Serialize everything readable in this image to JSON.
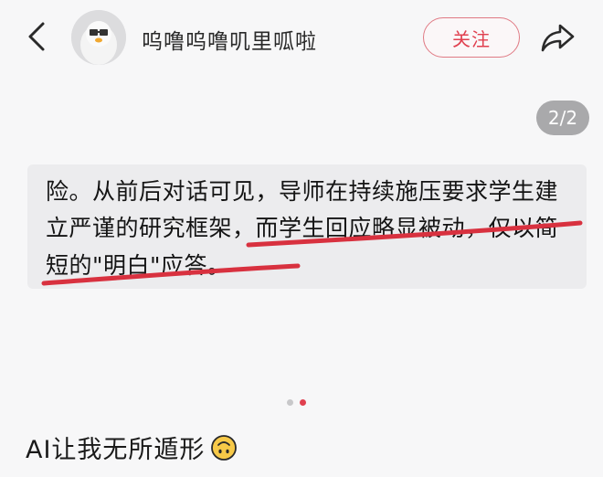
{
  "header": {
    "username": "呜噜呜噜叽里呱啦",
    "follow_label": "关注"
  },
  "gallery": {
    "page_indicator": "2/2",
    "current_index": 2,
    "total": 2
  },
  "content": {
    "line1": "险。从前后对话可见，导师在持续施压要求学生建",
    "line2": "立严谨的研究框架，而学生回应略显被动，仅以简",
    "line3": "短的\"明白\"应答。"
  },
  "caption": {
    "text": "AI让我无所遁形"
  },
  "icons": {
    "back": "chevron-left-icon",
    "share": "share-arrow-icon",
    "emoji": "upside-down-face-emoji"
  },
  "colors": {
    "accent": "#e0404f",
    "underline": "#d8313f",
    "dot_active": "#e0404f",
    "dot_inactive": "#c8c8ca"
  }
}
